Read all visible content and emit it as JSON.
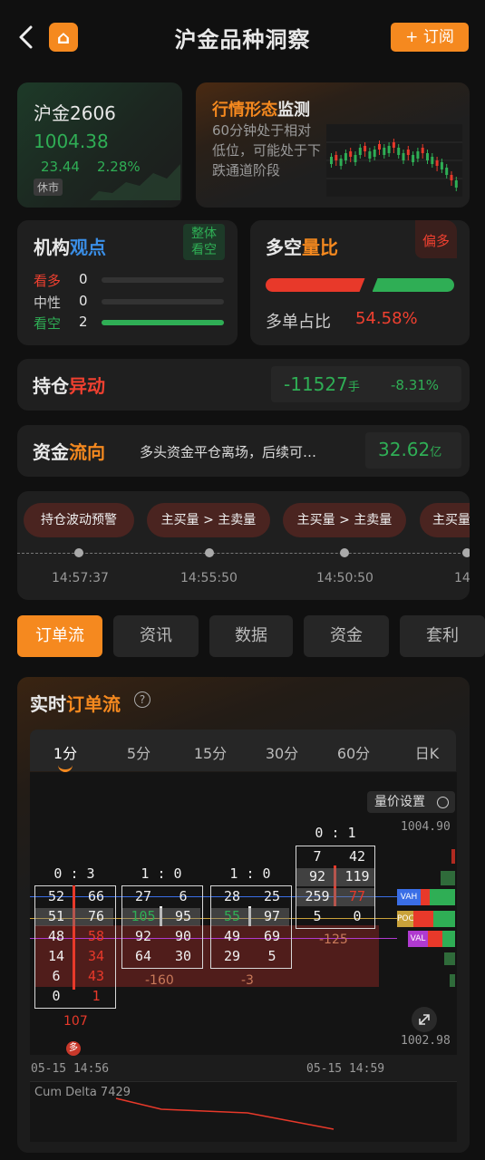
{
  "header": {
    "title": "沪金品种洞察",
    "subscribe_label": "+ 订阅",
    "logo_glyph": "⌂"
  },
  "quote": {
    "name": "沪金2606",
    "price": "1004.38",
    "change": "23.44",
    "change_pct": "2.28%",
    "status": "休市"
  },
  "pattern": {
    "title_a": "行情形态",
    "title_b": "监测",
    "desc": "60分钟处于相对低位，可能处于下跌通道阶段"
  },
  "institution": {
    "title_a": "机构",
    "title_b": "观点",
    "badge": "整体\n看空",
    "rows": [
      {
        "label": "看多",
        "count": "0",
        "ratio": 0
      },
      {
        "label": "中性",
        "count": "0",
        "ratio": 0
      },
      {
        "label": "看空",
        "count": "2",
        "ratio": 1
      }
    ]
  },
  "longshort": {
    "title_a": "多空",
    "title_b": "量比",
    "badge": "偏多",
    "ratio_label": "多单占比",
    "ratio_value": "54.58%",
    "long_fraction": 0.5458
  },
  "position": {
    "title_a": "持仓",
    "title_b": "异动",
    "value": "-11527",
    "unit": "手",
    "pct": "-8.31%"
  },
  "capital": {
    "title_a": "资金",
    "title_b": "流向",
    "desc": "多头资金平仓离场，后续可…",
    "value": "32.62",
    "unit": "亿"
  },
  "alerts": {
    "pills": [
      "持仓波动预警",
      "主买量 > 主卖量",
      "主买量 > 主卖量",
      "主买量"
    ],
    "times": [
      "14:57:37",
      "14:55:50",
      "14:50:50",
      "14"
    ]
  },
  "tabs": [
    "订单流",
    "资讯",
    "数据",
    "资金",
    "套利"
  ],
  "orderflow": {
    "title_a": "实时",
    "title_b": "订单流",
    "help_icon": "?",
    "timeframes": [
      "1分",
      "5分",
      "15分",
      "30分",
      "60分",
      "日K"
    ],
    "settings_label": "量价设置",
    "price_high": "1004.90",
    "price_low": "1002.98",
    "markers": [
      "VAH",
      "POC",
      "VAL"
    ],
    "time_left": "05-15 14:56",
    "time_right": "05-15 14:59",
    "cum_delta_label": "Cum Delta 7429",
    "candles": [
      {
        "header": "0 : 3",
        "rows": [
          [
            "52",
            "66"
          ],
          [
            "51",
            "76"
          ],
          [
            "48",
            "58"
          ],
          [
            "14",
            "34"
          ],
          [
            "6",
            "43"
          ],
          [
            "0",
            "1"
          ]
        ],
        "delta": "107"
      },
      {
        "header": "1 : 0",
        "rows": [
          [
            "27",
            "6"
          ],
          [
            "105",
            "95"
          ],
          [
            "92",
            "90"
          ],
          [
            "64",
            "30"
          ]
        ],
        "delta": "-160"
      },
      {
        "header": "1 : 0",
        "rows": [
          [
            "28",
            "25"
          ],
          [
            "55",
            "97"
          ],
          [
            "49",
            "69"
          ],
          [
            "29",
            "5"
          ]
        ],
        "delta": "-3"
      },
      {
        "header": "0 : 1",
        "rows": [
          [
            "7",
            "42"
          ],
          [
            "92",
            "119"
          ],
          [
            "259",
            "77"
          ],
          [
            "5",
            "0"
          ]
        ],
        "delta": "-125"
      }
    ],
    "delta_badge": "多"
  },
  "colors": {
    "accent": "#f5891f",
    "up": "#f04030",
    "down": "#2fae55",
    "blue": "#3a8ee6"
  }
}
